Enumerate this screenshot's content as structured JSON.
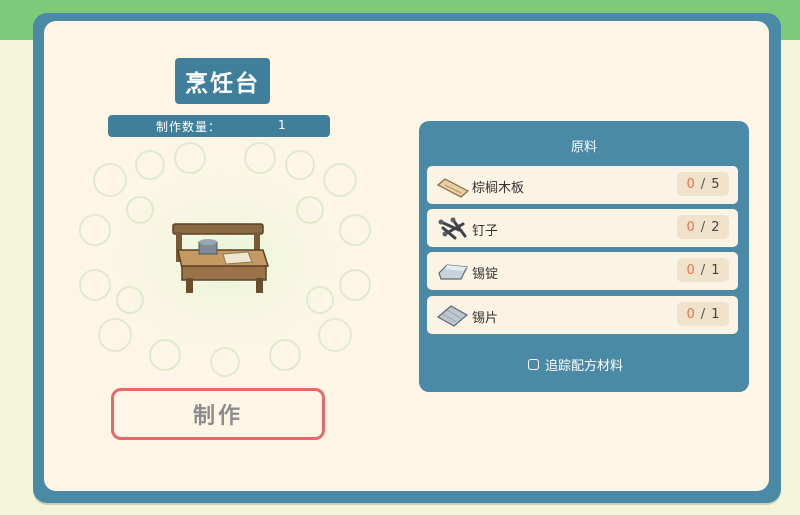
{
  "station": {
    "title": "烹饪台",
    "quantity_label": "制作数量：",
    "quantity_value": "1",
    "make_button": "制作"
  },
  "materials": {
    "header": "原料",
    "items": [
      {
        "name": "棕榈木板",
        "have": "0",
        "sep": "/",
        "need": "5",
        "icon": "wood-plank-icon"
      },
      {
        "name": "钉子",
        "have": "0",
        "sep": "/",
        "need": "2",
        "icon": "nails-icon"
      },
      {
        "name": "锡锭",
        "have": "0",
        "sep": "/",
        "need": "1",
        "icon": "tin-ingot-icon"
      },
      {
        "name": "锡片",
        "have": "0",
        "sep": "/",
        "need": "1",
        "icon": "tin-sheet-icon"
      }
    ],
    "track_label": "追踪配方材料",
    "track_checked": false
  },
  "colors": {
    "frame": "#4a8aa6",
    "panel": "#fdf6e6",
    "button_border": "#e8686a",
    "have_count": "#e8734f"
  }
}
